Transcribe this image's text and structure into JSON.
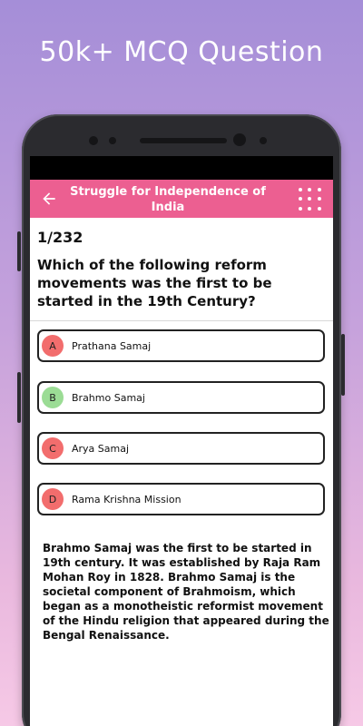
{
  "promo": {
    "headline": "50k+  MCQ Question"
  },
  "appbar": {
    "title": "Struggle for Independence of India",
    "color": "#ec5f91",
    "back_icon": "arrow-left-icon",
    "menu_icon": "grid-dots-icon"
  },
  "quiz": {
    "counter": "1/232",
    "question": "Which of the following reform movements was the first to be started in the 19th Century?",
    "options": [
      {
        "letter": "A",
        "text": "Prathana Samaj",
        "state": "wrong",
        "color": "#f26d6d"
      },
      {
        "letter": "B",
        "text": "Brahmo Samaj",
        "state": "correct",
        "color": "#9bdc95"
      },
      {
        "letter": "C",
        "text": "Arya Samaj",
        "state": "wrong",
        "color": "#f26d6d"
      },
      {
        "letter": "D",
        "text": "Rama Krishna Mission",
        "state": "wrong",
        "color": "#f26d6d"
      }
    ],
    "explanation": "Brahmo Samaj was the first to be started in 19th century. It was established by Raja Ram Mohan Roy in 1828. Brahmo Samaj is the societal component of Brahmoism, which began as a monotheistic reformist movement of the Hindu religion that appeared during the Bengal Renaissance."
  }
}
